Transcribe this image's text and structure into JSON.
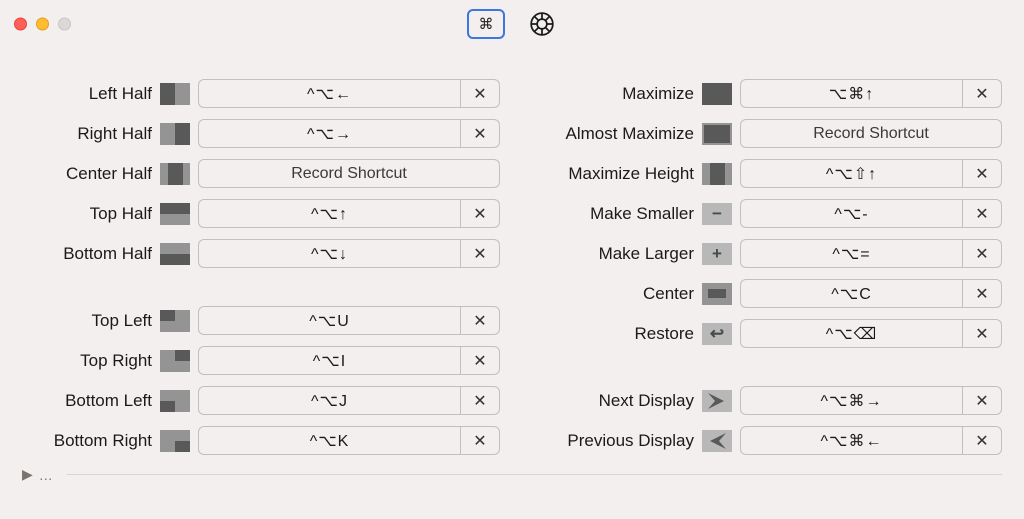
{
  "toolbar": {
    "cmd_glyph": "⌘"
  },
  "placeholder": "Record Shortcut",
  "clear_glyph": "✕",
  "left": {
    "group1": [
      {
        "id": "left-half",
        "label": "Left Half",
        "icon": "i-left-half",
        "shortcut": "^⌥←"
      },
      {
        "id": "right-half",
        "label": "Right Half",
        "icon": "i-right-half",
        "shortcut": "^⌥→"
      },
      {
        "id": "center-half",
        "label": "Center Half",
        "icon": "i-center-half",
        "shortcut": ""
      },
      {
        "id": "top-half",
        "label": "Top Half",
        "icon": "i-top-half",
        "shortcut": "^⌥↑"
      },
      {
        "id": "bottom-half",
        "label": "Bottom Half",
        "icon": "i-bottom-half",
        "shortcut": "^⌥↓"
      }
    ],
    "group2": [
      {
        "id": "top-left",
        "label": "Top Left",
        "icon": "i-top-left",
        "shortcut": "^⌥U"
      },
      {
        "id": "top-right",
        "label": "Top Right",
        "icon": "i-top-right",
        "shortcut": "^⌥I"
      },
      {
        "id": "bottom-left",
        "label": "Bottom Left",
        "icon": "i-bottom-left",
        "shortcut": "^⌥J"
      },
      {
        "id": "bottom-right",
        "label": "Bottom Right",
        "icon": "i-bottom-right",
        "shortcut": "^⌥K"
      }
    ]
  },
  "right": {
    "group1": [
      {
        "id": "maximize",
        "label": "Maximize",
        "icon": "i-maximize",
        "shortcut": "⌥⌘↑"
      },
      {
        "id": "almost-maximize",
        "label": "Almost Maximize",
        "icon": "i-almost-max",
        "shortcut": ""
      },
      {
        "id": "maximize-height",
        "label": "Maximize Height",
        "icon": "i-max-height",
        "shortcut": "^⌥⇧↑"
      },
      {
        "id": "make-smaller",
        "label": "Make Smaller",
        "symbol": "−",
        "shortcut": "^⌥-"
      },
      {
        "id": "make-larger",
        "label": "Make Larger",
        "symbol": "+",
        "shortcut": "^⌥="
      },
      {
        "id": "center",
        "label": "Center",
        "icon": "i-center-small",
        "shortcut": "^⌥C"
      },
      {
        "id": "restore",
        "label": "Restore",
        "symbol": "↩",
        "shortcut": "^⌥⌫"
      }
    ],
    "group2": [
      {
        "id": "next-display",
        "label": "Next Display",
        "arrow": "right",
        "shortcut": "^⌥⌘→"
      },
      {
        "id": "previous-display",
        "label": "Previous Display",
        "arrow": "left",
        "shortcut": "^⌥⌘←"
      }
    ]
  },
  "footer": {
    "disclosure": "▶",
    "dots": "…"
  }
}
